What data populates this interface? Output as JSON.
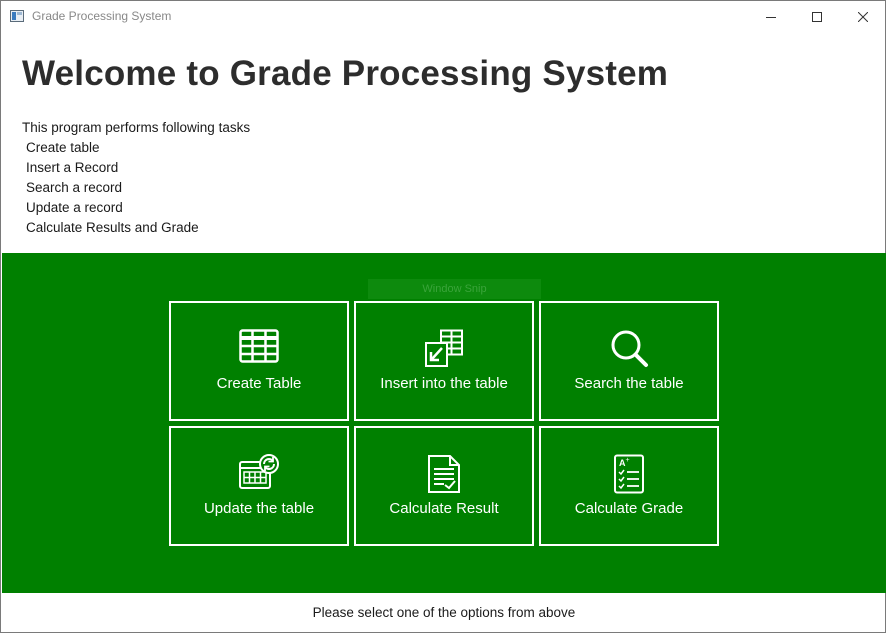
{
  "window": {
    "title": "Grade Processing System"
  },
  "header": {
    "heading": "Welcome to Grade Processing System",
    "intro": "This program performs following tasks",
    "tasks": [
      "Create table",
      "Insert a Record",
      "Search a record",
      "Update a record",
      "Calculate Results and Grade"
    ]
  },
  "panel": {
    "background_color": "#008000",
    "overlay_text": "Window Snip",
    "tiles": [
      {
        "label": "Create Table",
        "icon": "table-grid-icon"
      },
      {
        "label": "Insert into the table",
        "icon": "insert-table-icon"
      },
      {
        "label": "Search the table",
        "icon": "magnifier-icon"
      },
      {
        "label": "Update the table",
        "icon": "update-table-icon"
      },
      {
        "label": "Calculate Result",
        "icon": "result-document-icon"
      },
      {
        "label": "Calculate Grade",
        "icon": "grade-checklist-icon"
      }
    ]
  },
  "status": {
    "message": "Please select one of the options from above"
  }
}
